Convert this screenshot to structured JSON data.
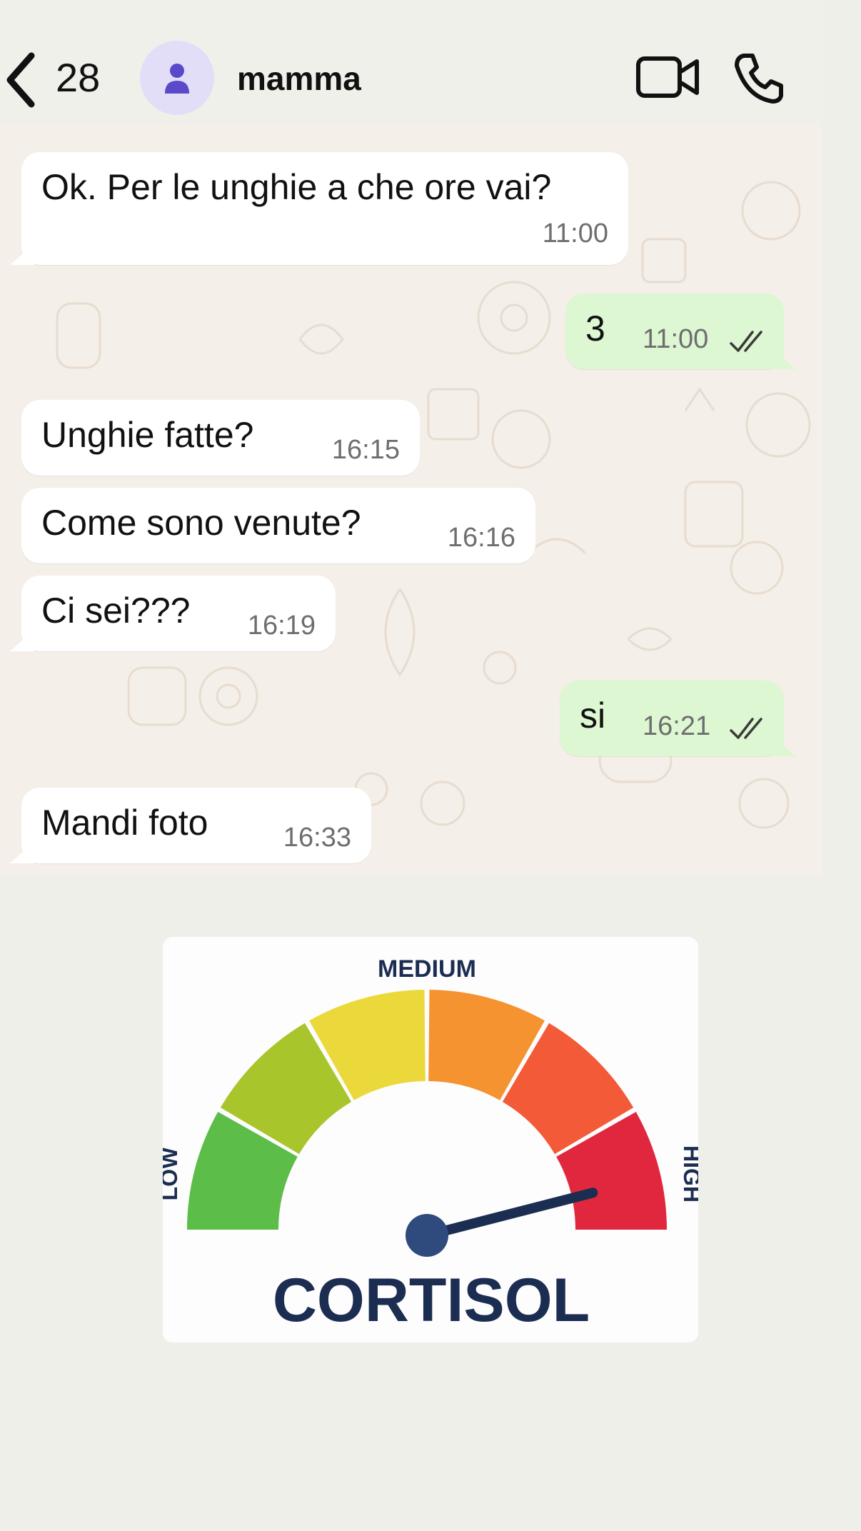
{
  "header": {
    "unread_count": "28",
    "contact_name": "mamma",
    "icons": [
      "chevron-left-icon",
      "person-icon",
      "video-call-icon",
      "phone-icon"
    ]
  },
  "messages": [
    {
      "direction": "incoming",
      "text": "Ok. Per le unghie a che ore vai?",
      "time": "11:00"
    },
    {
      "direction": "outgoing",
      "text": "3",
      "time": "11:00",
      "status": "read"
    },
    {
      "direction": "incoming",
      "text": "Unghie fatte?",
      "time": "16:15"
    },
    {
      "direction": "incoming",
      "text": "Come sono venute?",
      "time": "16:16"
    },
    {
      "direction": "incoming",
      "text": "Ci sei???",
      "time": "16:19"
    },
    {
      "direction": "outgoing",
      "text": "si",
      "time": "16:21",
      "status": "read"
    },
    {
      "direction": "incoming",
      "text": "Mandi foto",
      "time": "16:33"
    }
  ],
  "meme": {
    "label_low": "LOW",
    "label_medium": "MEDIUM",
    "label_high": "HIGH",
    "title": "CORTISOL",
    "level_percent": 92,
    "colors": [
      "#5cbd48",
      "#a9c52c",
      "#ebd93c",
      "#f59331",
      "#f35a38",
      "#e0273e"
    ],
    "needle_color": "#1c2d52"
  }
}
